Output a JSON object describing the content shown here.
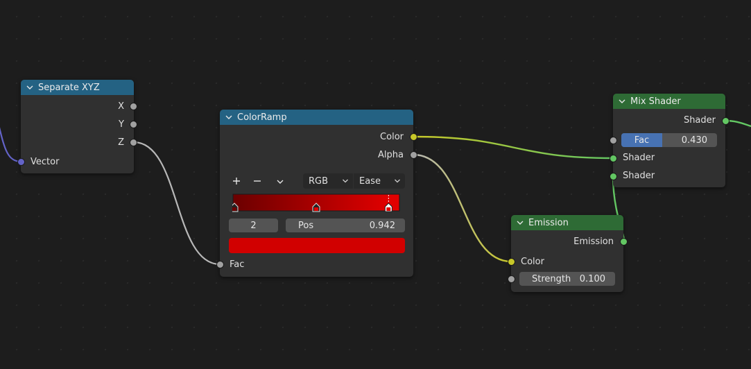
{
  "colors": {
    "background": "#1d1d1d",
    "node_body": "#303030",
    "header_converter": "#246283",
    "header_shader": "#2e6b35",
    "socket_vector": "#6363c7",
    "socket_float": "#a1a1a1",
    "socket_color": "#c7c729",
    "socket_shader": "#63c763",
    "fac_fill": "#4772b3",
    "ramp_dark": "#6b0000",
    "ramp_bright": "#e10000",
    "preview_color": "#d10000"
  },
  "nodes": {
    "separate_xyz": {
      "title": "Separate XYZ",
      "outputs": [
        "X",
        "Y",
        "Z"
      ],
      "input": "Vector"
    },
    "color_ramp": {
      "title": "ColorRamp",
      "outputs": [
        "Color",
        "Alpha"
      ],
      "color_mode": "RGB",
      "interpolation": "Ease",
      "active_stop_index": "2",
      "pos_label": "Pos",
      "pos_value": "0.942",
      "input": "Fac",
      "stops": [
        0.0,
        0.5,
        0.942
      ]
    },
    "mix_shader": {
      "title": "Mix Shader",
      "output": "Shader",
      "fac_label": "Fac",
      "fac_value": "0.430",
      "fac_fraction": 0.43,
      "inputs": [
        "Shader",
        "Shader"
      ]
    },
    "emission": {
      "title": "Emission",
      "output": "Emission",
      "color_input": "Color",
      "strength_label": "Strength",
      "strength_value": "0.100"
    }
  }
}
